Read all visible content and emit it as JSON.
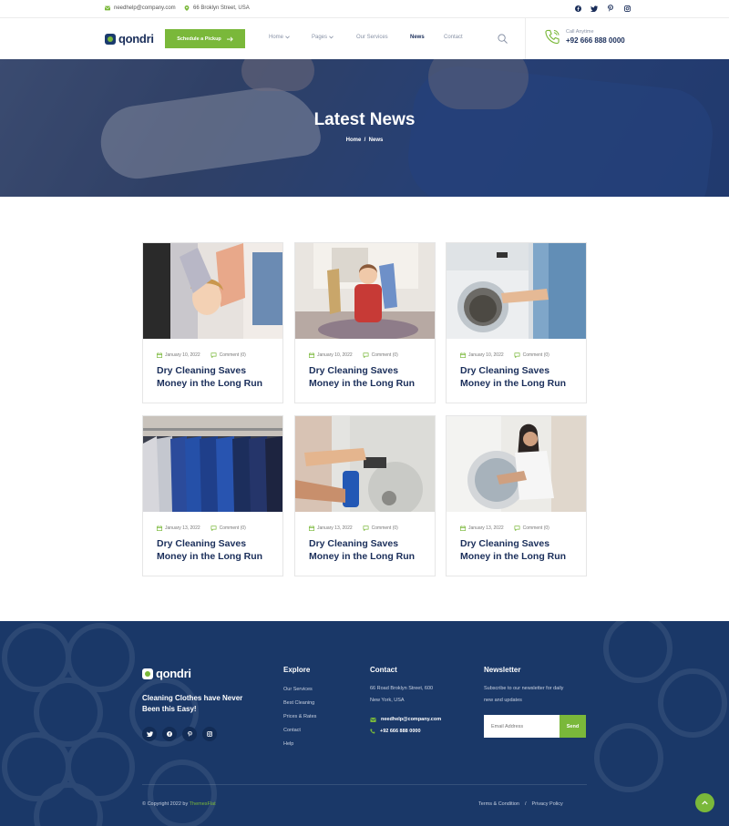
{
  "topbar": {
    "email": "needhelp@company.com",
    "address": "66 Broklyn Street, USA",
    "social": [
      "facebook-icon",
      "twitter-icon",
      "pinterest-icon",
      "instagram-icon"
    ]
  },
  "header": {
    "logo": "qondri",
    "cta": "Schedule a Pickup",
    "nav": [
      {
        "label": "Home",
        "dropdown": true
      },
      {
        "label": "Pages",
        "dropdown": true
      },
      {
        "label": "Our Services",
        "dropdown": false
      },
      {
        "label": "News",
        "dropdown": false,
        "active": true
      },
      {
        "label": "Contact",
        "dropdown": false
      }
    ],
    "call_label": "Call Anytime",
    "call_number": "+92 666 888 0000"
  },
  "hero": {
    "title": "Latest News",
    "breadcrumb_home": "Home",
    "breadcrumb_sep": "/",
    "breadcrumb_current": "News"
  },
  "posts": [
    {
      "date": "January 10, 2022",
      "comments": "Comment (0)",
      "title": "Dry Cleaning Saves Money in the Long Run"
    },
    {
      "date": "January 10, 2022",
      "comments": "Comment (0)",
      "title": "Dry Cleaning Saves Money in the Long Run"
    },
    {
      "date": "January 10, 2022",
      "comments": "Comment (0)",
      "title": "Dry Cleaning Saves Money in the Long Run"
    },
    {
      "date": "January 13, 2022",
      "comments": "Comment (0)",
      "title": "Dry Cleaning Saves Money in the Long Run"
    },
    {
      "date": "January 13, 2022",
      "comments": "Comment (0)",
      "title": "Dry Cleaning Saves Money in the Long Run"
    },
    {
      "date": "January 13, 2022",
      "comments": "Comment (0)",
      "title": "Dry Cleaning Saves Money in the Long Run"
    }
  ],
  "footer": {
    "logo": "qondri",
    "tagline": "Cleaning Clothes have Never Been this Easy!",
    "explore_heading": "Explore",
    "explore_links": [
      "Our Services",
      "Best Cleaning",
      "Prices & Rates",
      "Contact",
      "Help"
    ],
    "contact_heading": "Contact",
    "contact_address_line1": "66 Road Broklyn Street, 600",
    "contact_address_line2": "New York, USA",
    "contact_email": "needhelp@company.com",
    "contact_phone": "+92 666 888 0000",
    "newsletter_heading": "Newsletter",
    "newsletter_text_line1": "Subscribe to our newsletter for daily",
    "newsletter_text_line2": "new and updates",
    "newsletter_placeholder": "Email Address",
    "newsletter_button": "Send",
    "copyright_prefix": "© Copyright 2022 by",
    "copyright_brand": "ThemesFlat",
    "terms": "Terms & Condition",
    "legal_sep": "/",
    "privacy": "Privacy Policy"
  },
  "colors": {
    "navy": "#1a2e5a",
    "green": "#7ab83a",
    "footer_bg": "#1a3868"
  }
}
